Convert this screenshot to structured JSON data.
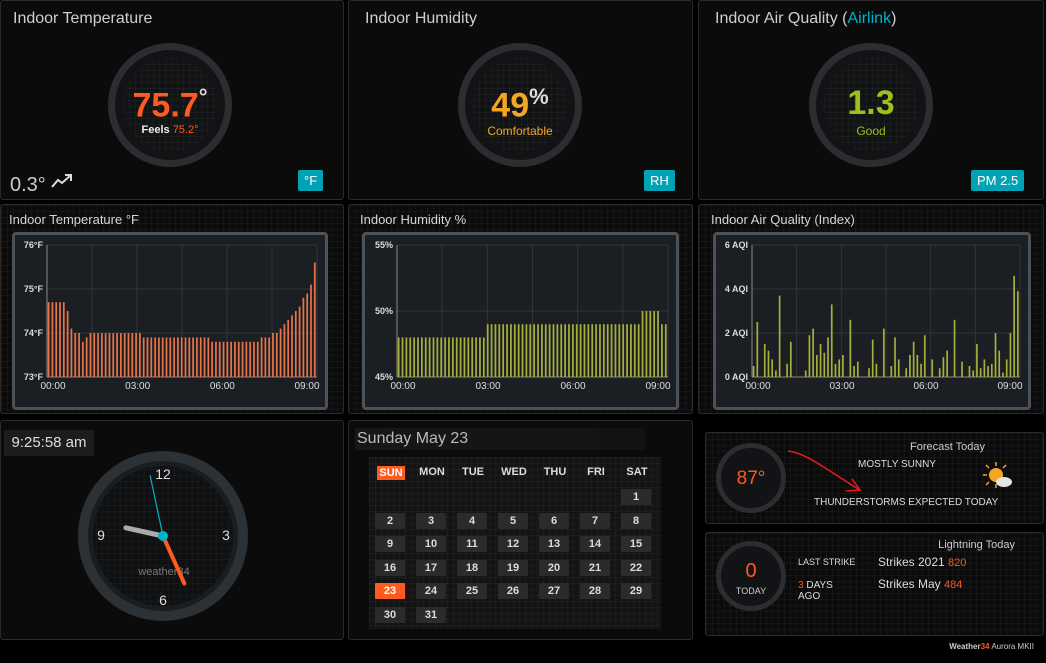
{
  "temp_panel": {
    "title": "Indoor Temperature",
    "value": "75.7",
    "unit": "°",
    "feels_label": "Feels",
    "feels_value": "75.2°",
    "trend_value": "0.3°",
    "badge": "°F",
    "color": "#ff5a1f"
  },
  "humidity_panel": {
    "title": "Indoor Humidity",
    "value": "49",
    "unit": "%",
    "status": "Comfortable",
    "badge": "RH",
    "color": "#f5a623"
  },
  "aq_panel": {
    "title_prefix": "Indoor Air Quality (",
    "title_link": "Airlink",
    "title_suffix": ")",
    "value": "1.3",
    "status": "Good",
    "badge": "PM 2.5",
    "color": "#9cc21a"
  },
  "charts": [
    {
      "title": "Indoor Temperature °F",
      "yticks": [
        "76°F",
        "75°F",
        "74°F",
        "73°F"
      ],
      "xticks": [
        "00:00",
        "03:00",
        "06:00",
        "09:00"
      ],
      "color": "#e8744a"
    },
    {
      "title": "Indoor Humidity %",
      "yticks": [
        "55%",
        "50%",
        "45%"
      ],
      "xticks": [
        "00:00",
        "03:00",
        "06:00",
        "09:00"
      ],
      "color": "#a7b03a"
    },
    {
      "title": "Indoor Air Quality (Index)",
      "yticks": [
        "6 AQI",
        "4 AQI",
        "2 AQI",
        "0 AQI"
      ],
      "xticks": [
        "00:00",
        "03:00",
        "06:00",
        "09:00"
      ],
      "color": "#a7b03a"
    }
  ],
  "chart_data": [
    {
      "type": "bar",
      "title": "Indoor Temperature °F",
      "ylim": [
        73,
        76
      ],
      "values": [
        74.7,
        74.7,
        74.7,
        74.7,
        74.7,
        74.5,
        74.1,
        74.0,
        74.0,
        73.8,
        73.9,
        74.0,
        74.0,
        74.0,
        74.0,
        74.0,
        74.0,
        74.0,
        74.0,
        74.0,
        74.0,
        74.0,
        74.0,
        74.0,
        74.0,
        73.9,
        73.9,
        73.9,
        73.9,
        73.9,
        73.9,
        73.9,
        73.9,
        73.9,
        73.9,
        73.9,
        73.9,
        73.9,
        73.9,
        73.9,
        73.9,
        73.9,
        73.9,
        73.8,
        73.8,
        73.8,
        73.8,
        73.8,
        73.8,
        73.8,
        73.8,
        73.8,
        73.8,
        73.8,
        73.8,
        73.8,
        73.9,
        73.9,
        73.9,
        74.0,
        74.0,
        74.1,
        74.2,
        74.3,
        74.4,
        74.5,
        74.6,
        74.8,
        74.9,
        75.1,
        75.6
      ]
    },
    {
      "type": "bar",
      "title": "Indoor Humidity %",
      "ylim": [
        45,
        55
      ],
      "values": [
        48,
        48,
        48,
        48,
        48,
        48,
        48,
        48,
        48,
        48,
        48,
        48,
        48,
        48,
        48,
        48,
        48,
        48,
        48,
        48,
        48,
        48,
        48,
        49,
        49,
        49,
        49,
        49,
        49,
        49,
        49,
        49,
        49,
        49,
        49,
        49,
        49,
        49,
        49,
        49,
        49,
        49,
        49,
        49,
        49,
        49,
        49,
        49,
        49,
        49,
        49,
        49,
        49,
        49,
        49,
        49,
        49,
        49,
        49,
        49,
        49,
        49,
        49,
        50,
        50,
        50,
        50,
        50,
        49,
        49
      ]
    },
    {
      "type": "bar",
      "title": "Indoor Air Quality (Index)",
      "ylim": [
        0,
        6
      ],
      "values": [
        0.5,
        2.5,
        0,
        1.5,
        1.2,
        0.8,
        0.3,
        3.7,
        0,
        0.6,
        1.6,
        0,
        0,
        0,
        0.3,
        1.9,
        2.2,
        1.0,
        1.5,
        1.1,
        1.8,
        3.3,
        0.6,
        0.8,
        1.0,
        0,
        2.6,
        0.5,
        0.7,
        0,
        0,
        0.4,
        1.7,
        0.6,
        0,
        2.2,
        0,
        0.5,
        1.8,
        0.8,
        0,
        0.4,
        1.0,
        1.6,
        1.0,
        0.6,
        1.9,
        0,
        0.8,
        0,
        0.4,
        0.9,
        1.2,
        0,
        2.6,
        0,
        0.7,
        0,
        0.5,
        0.3,
        1.5,
        0.4,
        0.8,
        0.5,
        0.6,
        2.0,
        1.2,
        0.2,
        0.8,
        2.0,
        4.6,
        3.9
      ]
    }
  ],
  "clock": {
    "time": "9:25:58 am",
    "n12": "12",
    "n3": "3",
    "n6": "6",
    "n9": "9",
    "brand": "weather34",
    "hour": 9,
    "minute": 25,
    "second": 58
  },
  "calendar": {
    "title": "Sunday May 23",
    "days": [
      "SUN",
      "MON",
      "TUE",
      "WED",
      "THU",
      "FRI",
      "SAT"
    ],
    "today": "23",
    "weeks": [
      [
        "",
        "",
        "",
        "",
        "",
        "",
        "1"
      ],
      [
        "2",
        "3",
        "4",
        "5",
        "6",
        "7",
        "8"
      ],
      [
        "9",
        "10",
        "11",
        "12",
        "13",
        "14",
        "15"
      ],
      [
        "16",
        "17",
        "18",
        "19",
        "20",
        "21",
        "22"
      ],
      [
        "23",
        "24",
        "25",
        "26",
        "27",
        "28",
        "29"
      ],
      [
        "30",
        "31",
        "",
        "",
        "",
        "",
        ""
      ]
    ]
  },
  "forecast": {
    "title": "Forecast Today",
    "temp": "87°",
    "summary": "MOSTLY SUNNY",
    "detail": "THUNDERSTORMS EXPECTED TODAY",
    "accent": "#ff5a1f"
  },
  "lightning": {
    "title": "Lightning Today",
    "count": "0",
    "today_label": "TODAY",
    "last_label": "LAST STRIKE",
    "last_value": "3",
    "last_unit": "DAYS",
    "last_ago": "AGO",
    "year_label": "Strikes 2021",
    "year_value": "820",
    "month_label": "Strikes May",
    "month_value": "484"
  },
  "footer": {
    "brand_a": "Weather",
    "brand_b": "34",
    "brand_c": " Aurora MKII"
  }
}
